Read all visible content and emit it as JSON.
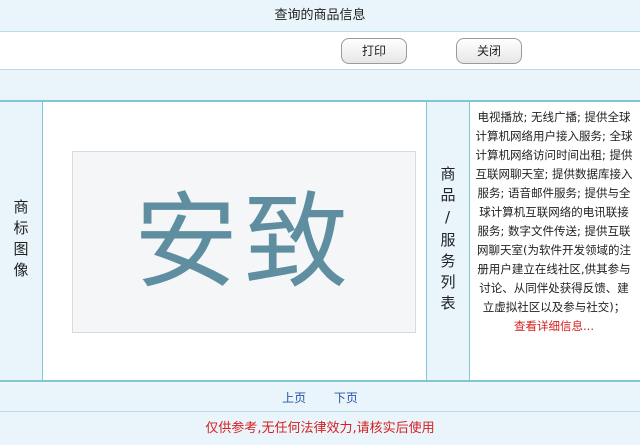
{
  "header": {
    "title": "查询的商品信息"
  },
  "toolbar": {
    "print_label": "打印",
    "close_label": "关闭"
  },
  "main": {
    "trademark_label": "商标图像",
    "trademark_text": "安致",
    "services_label": "商品/服务列表",
    "services_text": "电视播放; 无线广播; 提供全球计算机网络用户接入服务; 全球计算机网络访问时间出租; 提供互联网聊天室; 提供数据库接入服务; 语音邮件服务; 提供与全球计算机互联网络的电讯联接服务; 数字文件传送; 提供互联网聊天室(为软件开发领域的注册用户建立在线社区,供其参与讨论、从同伴处获得反馈、建立虚拟社区以及参与社交)；",
    "detail_link": "查看详细信息..."
  },
  "pager": {
    "prev": "上页",
    "next": "下页"
  },
  "footer": {
    "disclaimer": "仅供参考,无任何法律效力,请核实后使用"
  },
  "colors": {
    "accent_border": "#7fc6d6",
    "link": "#2255aa",
    "warning": "#d62020"
  }
}
